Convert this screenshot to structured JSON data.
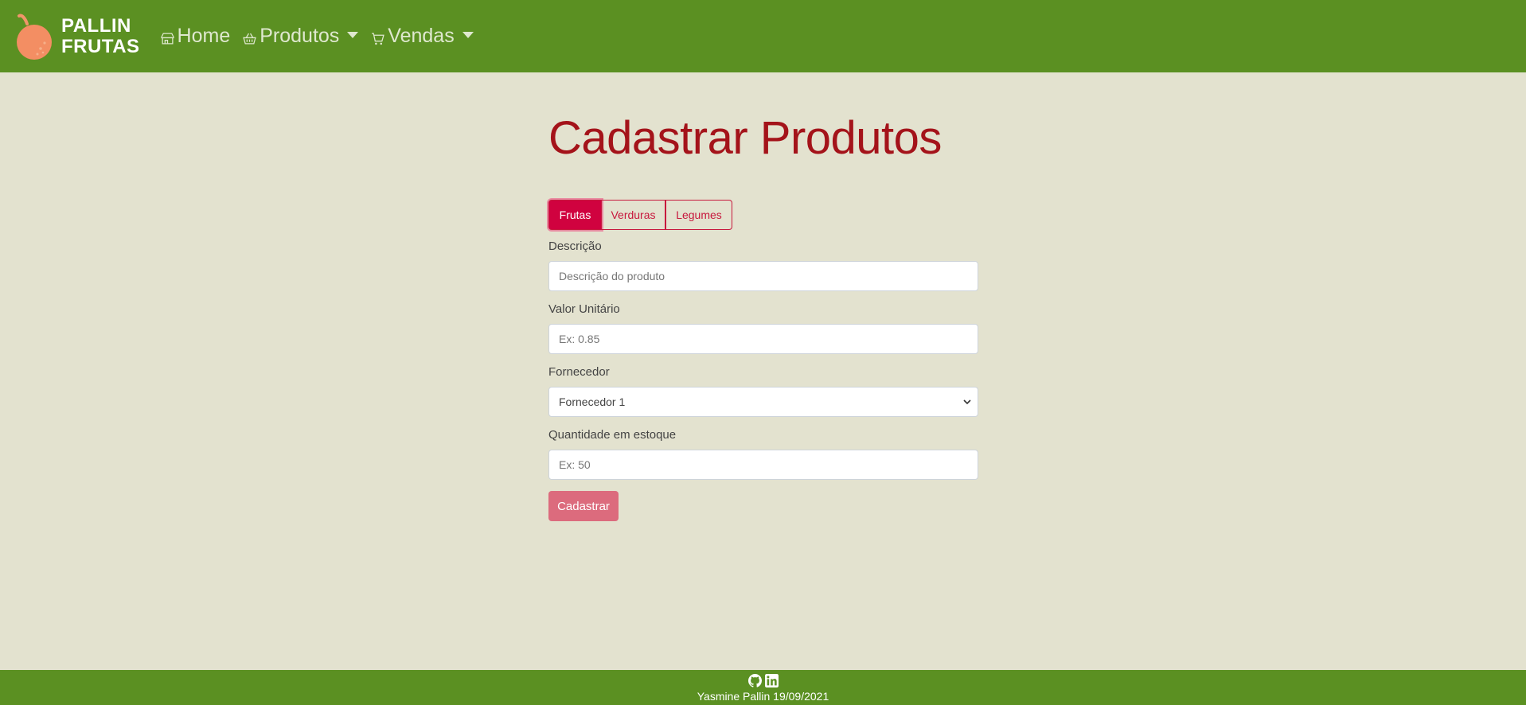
{
  "brand": {
    "line1": "PALLIN",
    "line2": "FRUTAS",
    "logo": "orange-fruit-logo"
  },
  "nav": {
    "home": "Home",
    "produtos": "Produtos",
    "vendas": "Vendas"
  },
  "page": {
    "title": "Cadastrar Produtos"
  },
  "categories": {
    "tabs": [
      "Frutas",
      "Verduras",
      "Legumes"
    ],
    "selected": "Frutas"
  },
  "form": {
    "descricao": {
      "label": "Descrição",
      "placeholder": "Descrição do produto"
    },
    "valor": {
      "label": "Valor Unitário",
      "placeholder": "Ex: 0.85"
    },
    "fornecedor": {
      "label": "Fornecedor",
      "value": "Fornecedor 1"
    },
    "quantidade": {
      "label": "Quantidade em estoque",
      "placeholder": "Ex: 50"
    },
    "submit": "Cadastrar"
  },
  "footer": {
    "text": "Yasmine Pallin 19/09/2021",
    "icons": [
      "github-icon",
      "linkedin-icon"
    ]
  },
  "colors": {
    "navbar": "#5b9022",
    "background": "#e3e2cf",
    "title": "#a4131a",
    "accent": "#d0023f",
    "submit": "#dc6b7d"
  }
}
